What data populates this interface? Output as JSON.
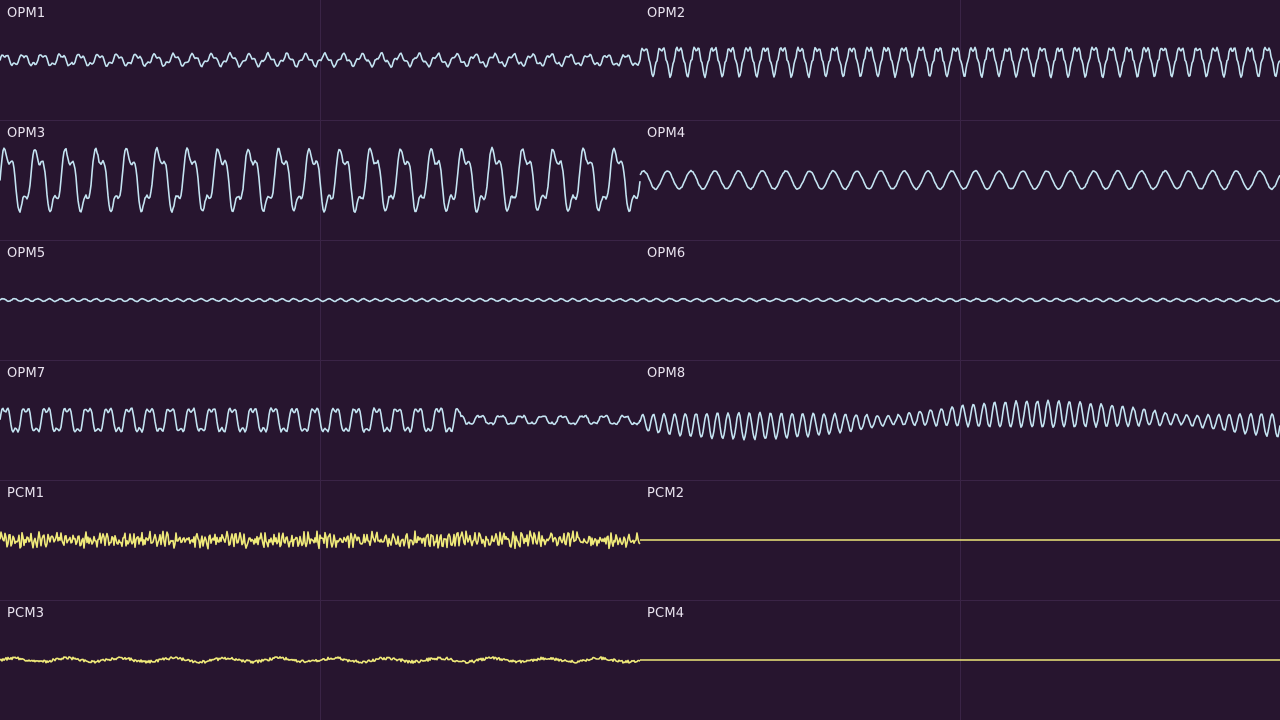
{
  "colors": {
    "background": "#27152f",
    "opm_wave": "#c4e4f2",
    "pcm_wave": "#f0ea7a",
    "label": "#e8e2ee",
    "grid_line": "#3a2446"
  },
  "channels": [
    {
      "label": "OPM1",
      "wave": "opm"
    },
    {
      "label": "OPM2",
      "wave": "opm"
    },
    {
      "label": "OPM3",
      "wave": "opm"
    },
    {
      "label": "OPM4",
      "wave": "opm"
    },
    {
      "label": "OPM5",
      "wave": "opm"
    },
    {
      "label": "OPM6",
      "wave": "opm"
    },
    {
      "label": "OPM7",
      "wave": "opm"
    },
    {
      "label": "OPM8",
      "wave": "opm"
    },
    {
      "label": "PCM1",
      "wave": "pcm"
    },
    {
      "label": "PCM2",
      "wave": "pcm"
    },
    {
      "label": "PCM3",
      "wave": "pcm"
    },
    {
      "label": "PCM4",
      "wave": "pcm"
    }
  ]
}
